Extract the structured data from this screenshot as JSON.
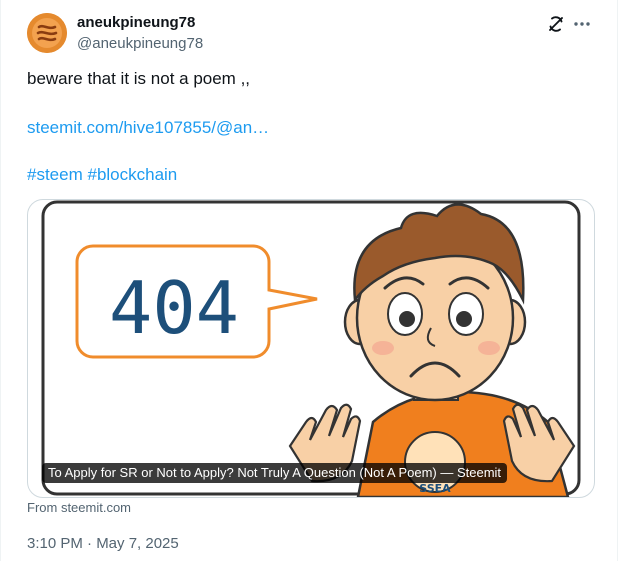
{
  "tweet": {
    "display_name": "aneukpineung78",
    "handle": "@aneukpineung78",
    "body": "beware that it is not a poem ,,",
    "link": "steemit.com/hive107855/@an…",
    "hashtags": [
      "#steem",
      "#blockchain"
    ],
    "timestamp": "3:10 PM · May 7, 2025"
  },
  "media": {
    "image_text": "404",
    "shirt_text": "SSEA",
    "caption": "To Apply for SR or Not to Apply? Not Truly A Question (Not A Poem) — Steemit",
    "source": "From steemit.com"
  },
  "icons": {
    "avatar": "steem-logo-icon",
    "grok": "grok-icon",
    "more": "more-dots-icon"
  },
  "colors": {
    "accent": "#1d9bf0",
    "muted": "#536471",
    "avatar_bg": "#e58a2e",
    "bubble_border": "#f08c2c",
    "digits": "#1d4f7a",
    "shirt": "#f07f1e"
  }
}
